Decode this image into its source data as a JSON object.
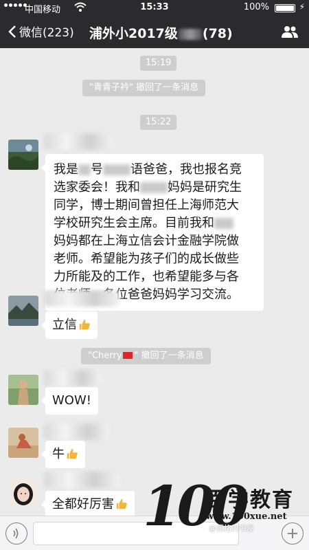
{
  "status_bar": {
    "carrier": "中国移动",
    "time": "15:33",
    "battery": "100%"
  },
  "nav": {
    "back_label": "微信(223)",
    "title_prefix": "浦外小2017级",
    "title_suffix": "(78)"
  },
  "messages": {
    "time_1": "15:19",
    "recall_1": "\"青青子衿\" 撤回了一条消息",
    "time_2": "15:22",
    "long_text": {
      "l1a": "我是",
      "l1b": "号",
      "l1c": "语爸爸，我也报名竞",
      "l2": "选家委会！我和",
      "l2b": "妈妈是研究生",
      "l3": "同学，博士期间曾担任上海师范大",
      "l4": "学校研究生会主席。目前我和",
      "l5": "妈妈都在上海立信会计金融学院做",
      "l6": "老师。希望能为孩子们的成长做些",
      "l7": "力所能及的工作，也希望能多与各",
      "l8": "位老师、各位爸爸妈妈学习交流。"
    },
    "lixin": "立信",
    "recall_2_a": "\"Cherry",
    "recall_2_b": "\" 撤回了一条消息",
    "wow": "WOW!",
    "niu": "牛",
    "lihai": "全都好厉害"
  },
  "watermark": {
    "logo": "100",
    "brand": "百学教育",
    "url": "www.100xue.net",
    "handle": "@佩格的书屋"
  },
  "colors": {
    "nav_bg": "#2b2b2f",
    "chat_bg": "#ebebeb",
    "pill_bg": "#cecece",
    "thumb_yellow": "#f3b43a"
  },
  "icons": {
    "back": "chevron-left-icon",
    "group_info": "people-icon",
    "voice": "voice-icon",
    "plus": "plus-icon",
    "thumbs_up": "thumbs-up-icon"
  }
}
